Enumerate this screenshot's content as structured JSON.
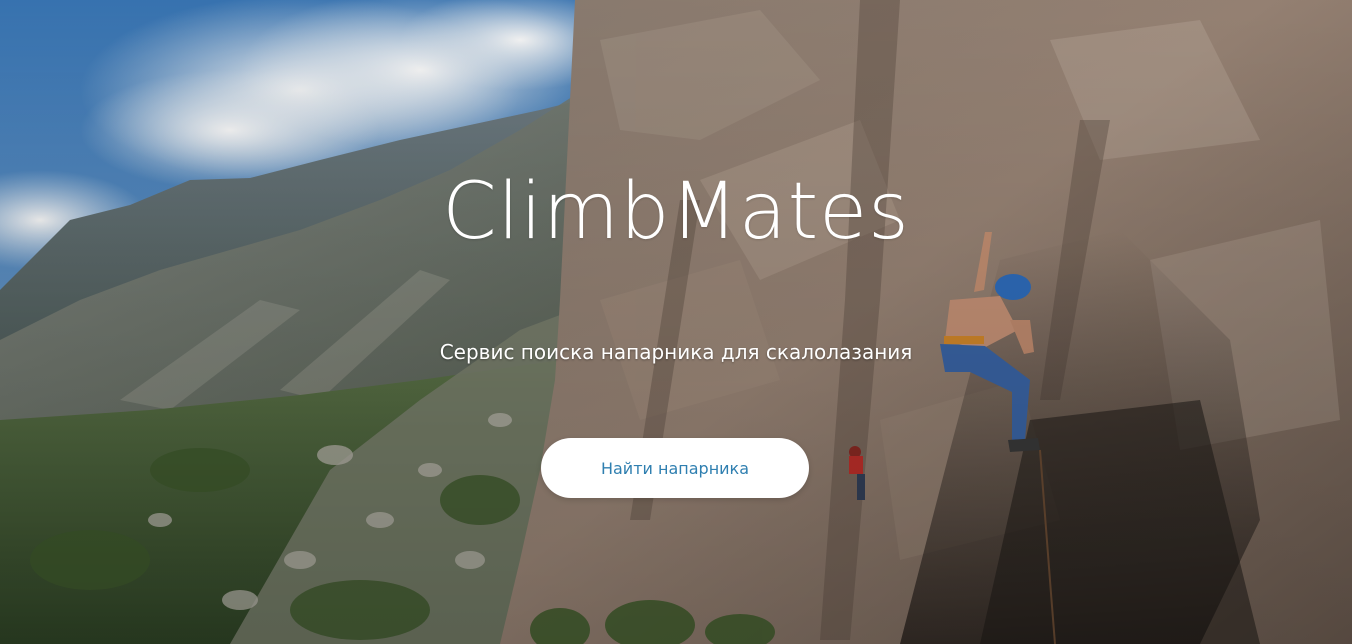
{
  "hero": {
    "title": "ClimbMates",
    "subtitle": "Сервис поиска напарника для скалолазания",
    "cta_label": "Найти напарника",
    "background_image": "mountain-valley-rock-climber-photo"
  },
  "colors": {
    "title_text": "#ffffff",
    "button_background": "#ffffff",
    "button_text": "#2f7fb0"
  }
}
